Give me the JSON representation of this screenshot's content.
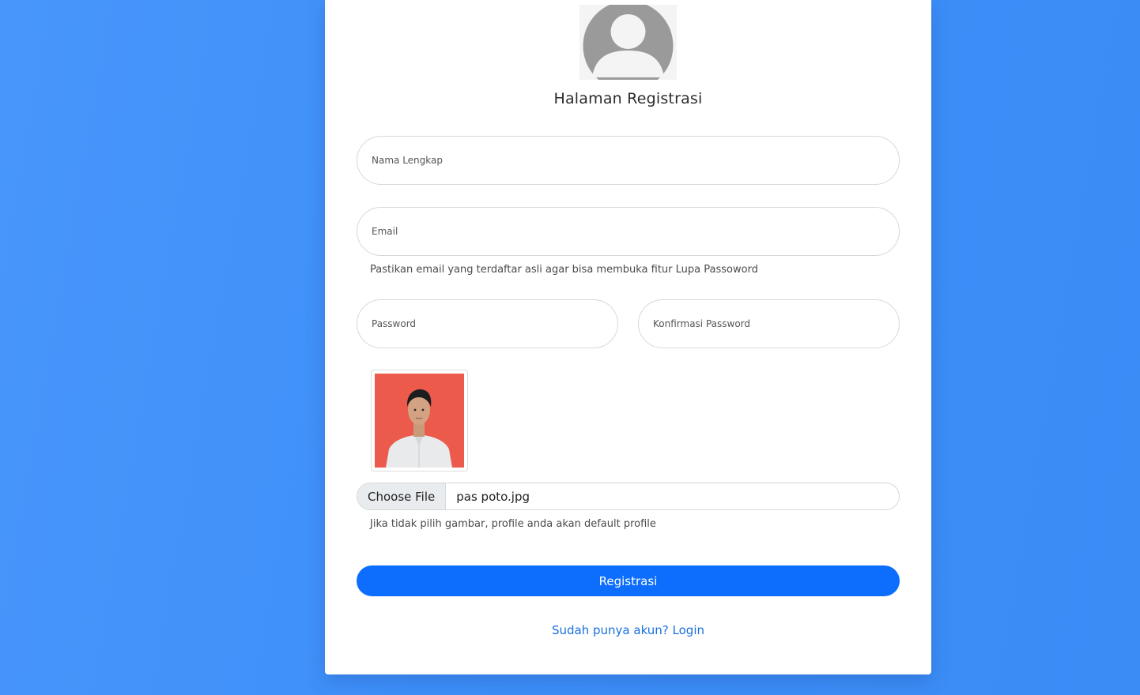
{
  "title": "Halaman Registrasi",
  "avatar_icon": "default-user-avatar",
  "fields": {
    "full_name_placeholder": "Nama Lengkap",
    "email_placeholder": "Email",
    "password_placeholder": "Password",
    "confirm_password_placeholder": "Konfirmasi Password"
  },
  "email_hint": "Pastikan email yang terdaftar asli agar bisa membuka fitur Lupa Passoword",
  "file_upload": {
    "button_label": "Choose File",
    "file_name": "pas poto.jpg",
    "hint": "Jika tidak pilih gambar, profile anda akan default profile"
  },
  "submit_label": "Registrasi",
  "login_link": "Sudah punya akun? Login",
  "colors": {
    "background": "#3d8ffa",
    "primary": "#0d6efd",
    "link": "#1a6fe0",
    "photo_background": "#ec5a4c"
  }
}
